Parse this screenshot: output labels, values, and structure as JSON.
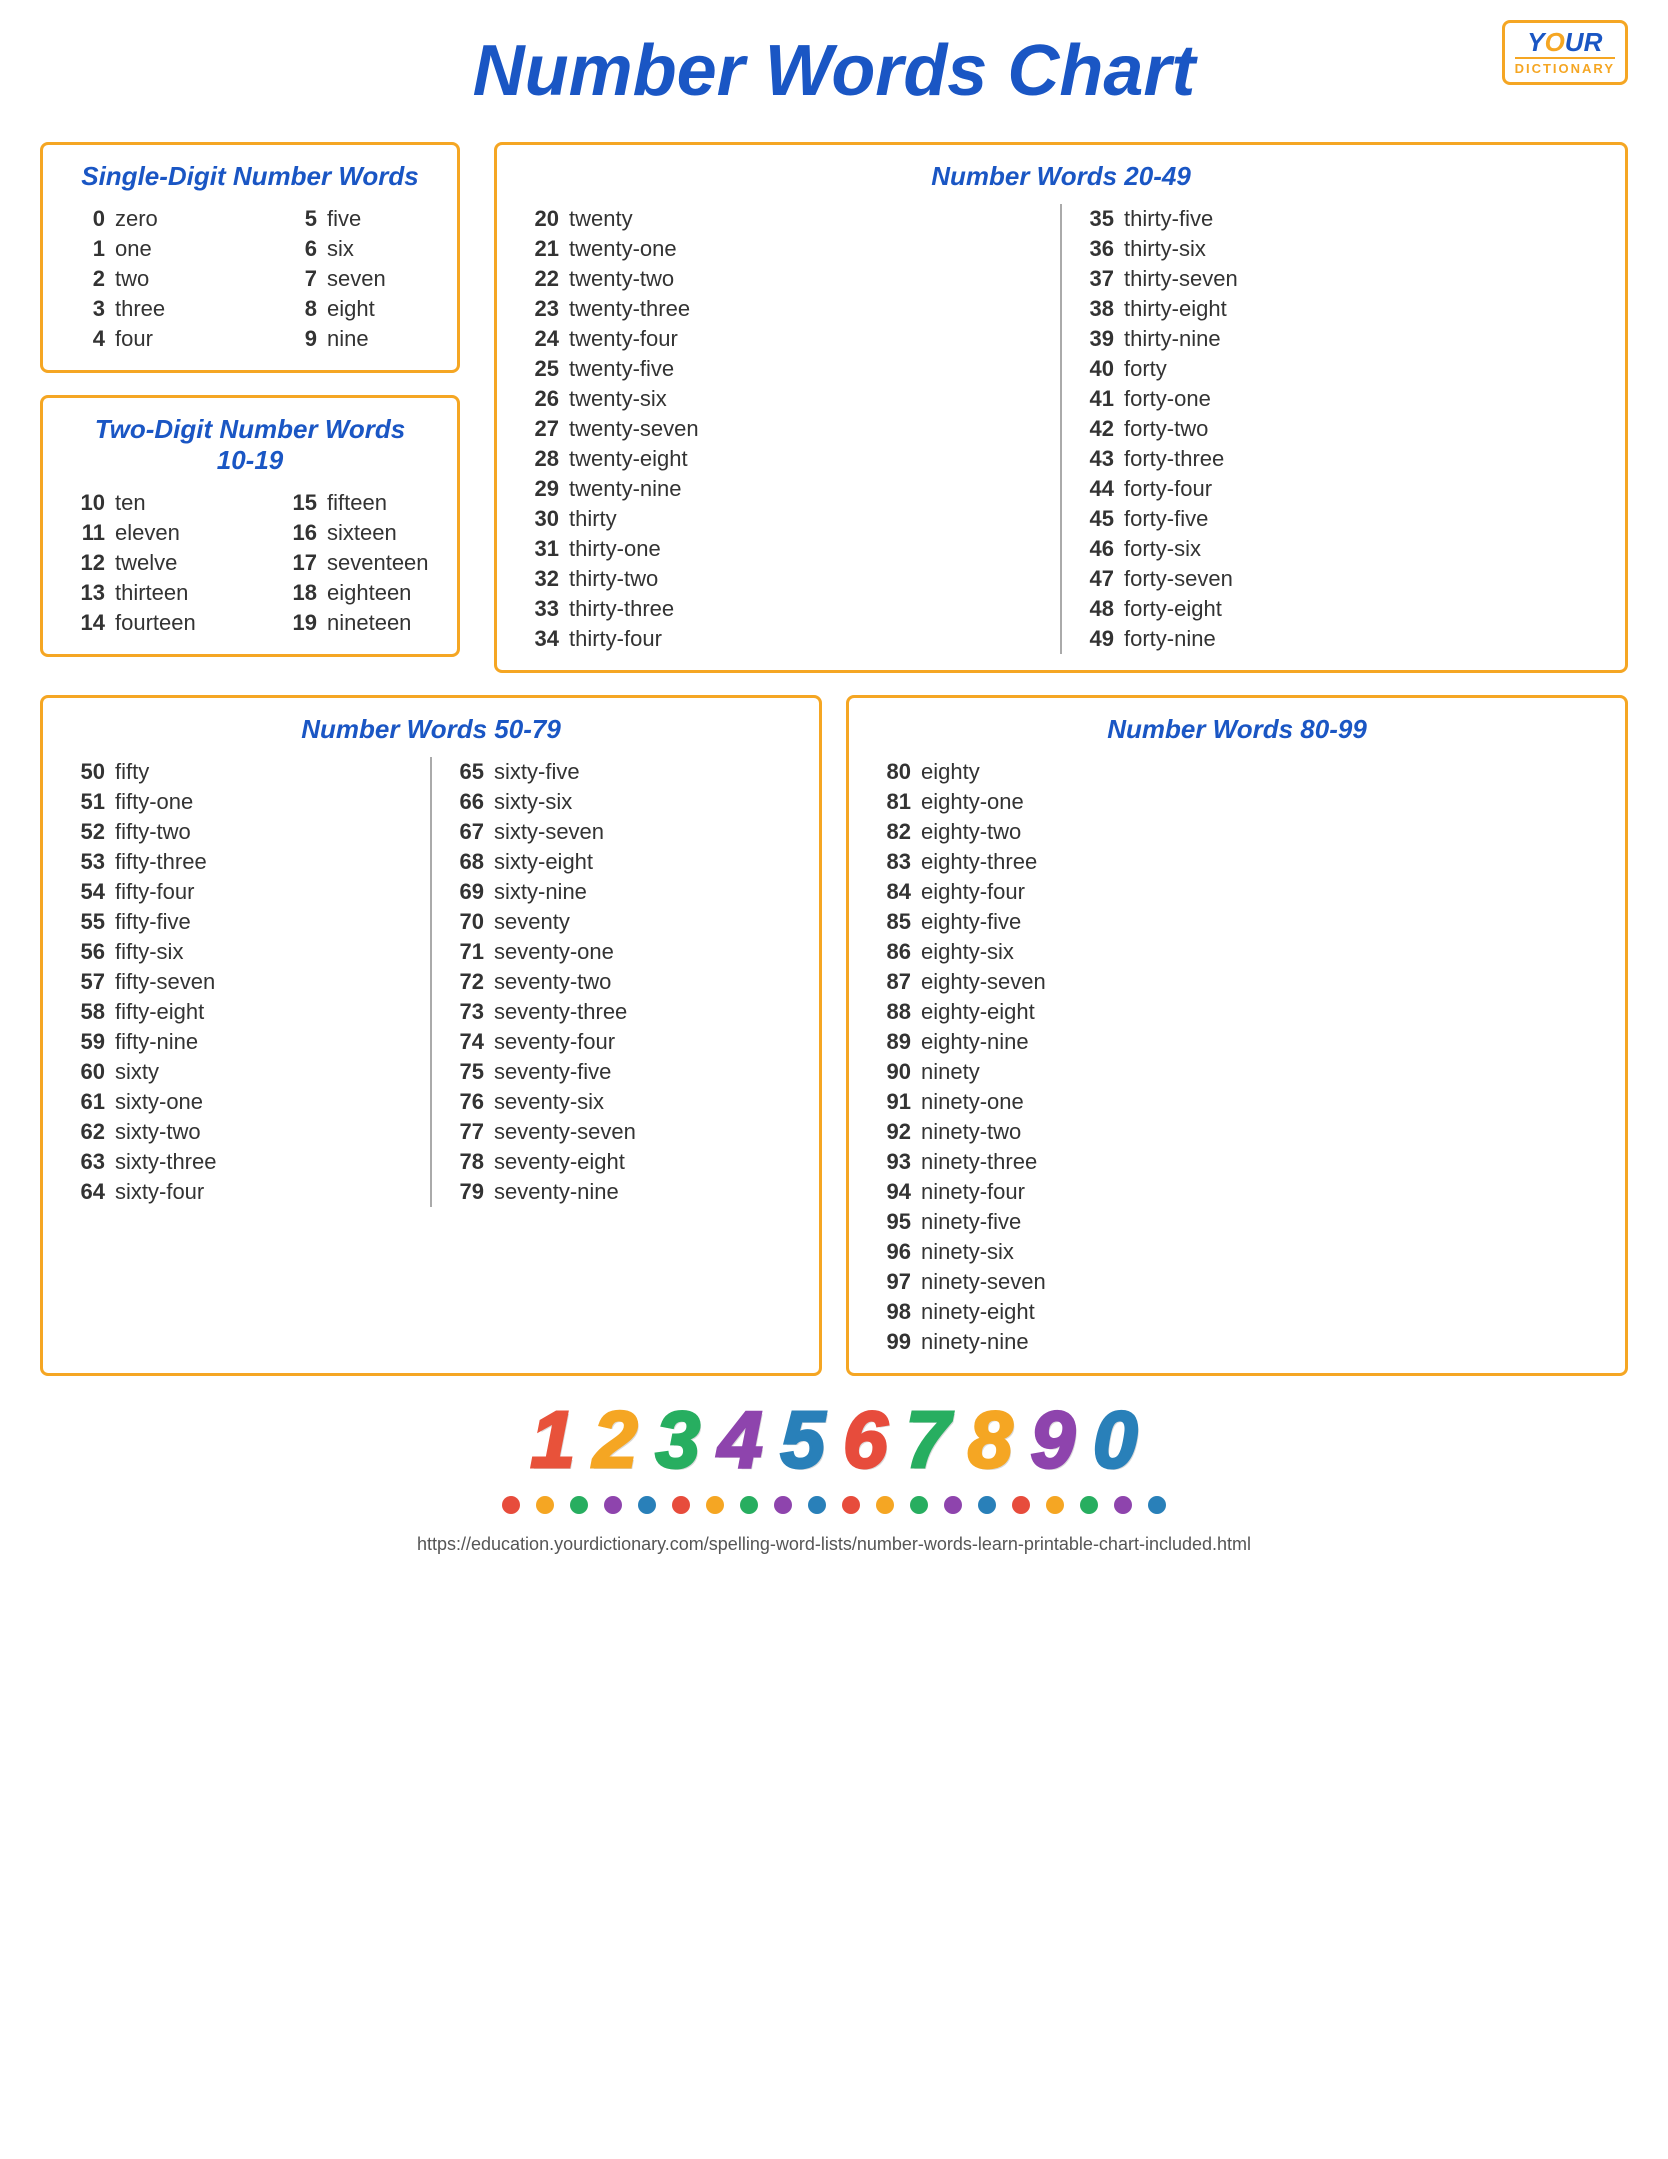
{
  "logo": {
    "your": "Y",
    "o": "O",
    "ur": "UR",
    "dictionary": "DICTIONARY"
  },
  "title": "Number Words Chart",
  "sections": {
    "single_digit": {
      "title": "Single-Digit Number Words",
      "left": [
        {
          "num": "0",
          "word": "zero"
        },
        {
          "num": "1",
          "word": "one"
        },
        {
          "num": "2",
          "word": "two"
        },
        {
          "num": "3",
          "word": "three"
        },
        {
          "num": "4",
          "word": "four"
        }
      ],
      "right": [
        {
          "num": "5",
          "word": "five"
        },
        {
          "num": "6",
          "word": "six"
        },
        {
          "num": "7",
          "word": "seven"
        },
        {
          "num": "8",
          "word": "eight"
        },
        {
          "num": "9",
          "word": "nine"
        }
      ]
    },
    "two_digit": {
      "title": "Two-Digit Number Words",
      "subtitle": "10-19",
      "left": [
        {
          "num": "10",
          "word": "ten"
        },
        {
          "num": "11",
          "word": "eleven"
        },
        {
          "num": "12",
          "word": "twelve"
        },
        {
          "num": "13",
          "word": "thirteen"
        },
        {
          "num": "14",
          "word": "fourteen"
        }
      ],
      "right": [
        {
          "num": "15",
          "word": "fifteen"
        },
        {
          "num": "16",
          "word": "sixteen"
        },
        {
          "num": "17",
          "word": "seventeen"
        },
        {
          "num": "18",
          "word": "eighteen"
        },
        {
          "num": "19",
          "word": "nineteen"
        }
      ]
    },
    "twenty_49": {
      "title": "Number Words 20-49",
      "left": [
        {
          "num": "20",
          "word": "twenty"
        },
        {
          "num": "21",
          "word": "twenty-one"
        },
        {
          "num": "22",
          "word": "twenty-two"
        },
        {
          "num": "23",
          "word": "twenty-three"
        },
        {
          "num": "24",
          "word": "twenty-four"
        },
        {
          "num": "25",
          "word": "twenty-five"
        },
        {
          "num": "26",
          "word": "twenty-six"
        },
        {
          "num": "27",
          "word": "twenty-seven"
        },
        {
          "num": "28",
          "word": "twenty-eight"
        },
        {
          "num": "29",
          "word": "twenty-nine"
        },
        {
          "num": "30",
          "word": "thirty"
        },
        {
          "num": "31",
          "word": "thirty-one"
        },
        {
          "num": "32",
          "word": "thirty-two"
        },
        {
          "num": "33",
          "word": "thirty-three"
        },
        {
          "num": "34",
          "word": "thirty-four"
        }
      ],
      "right": [
        {
          "num": "35",
          "word": "thirty-five"
        },
        {
          "num": "36",
          "word": "thirty-six"
        },
        {
          "num": "37",
          "word": "thirty-seven"
        },
        {
          "num": "38",
          "word": "thirty-eight"
        },
        {
          "num": "39",
          "word": "thirty-nine"
        },
        {
          "num": "40",
          "word": "forty"
        },
        {
          "num": "41",
          "word": "forty-one"
        },
        {
          "num": "42",
          "word": "forty-two"
        },
        {
          "num": "43",
          "word": "forty-three"
        },
        {
          "num": "44",
          "word": "forty-four"
        },
        {
          "num": "45",
          "word": "forty-five"
        },
        {
          "num": "46",
          "word": "forty-six"
        },
        {
          "num": "47",
          "word": "forty-seven"
        },
        {
          "num": "48",
          "word": "forty-eight"
        },
        {
          "num": "49",
          "word": "forty-nine"
        }
      ]
    },
    "fifty_79": {
      "title": "Number Words 50-79",
      "left": [
        {
          "num": "50",
          "word": "fifty"
        },
        {
          "num": "51",
          "word": "fifty-one"
        },
        {
          "num": "52",
          "word": "fifty-two"
        },
        {
          "num": "53",
          "word": "fifty-three"
        },
        {
          "num": "54",
          "word": "fifty-four"
        },
        {
          "num": "55",
          "word": "fifty-five"
        },
        {
          "num": "56",
          "word": "fifty-six"
        },
        {
          "num": "57",
          "word": "fifty-seven"
        },
        {
          "num": "58",
          "word": "fifty-eight"
        },
        {
          "num": "59",
          "word": "fifty-nine"
        },
        {
          "num": "60",
          "word": "sixty"
        },
        {
          "num": "61",
          "word": "sixty-one"
        },
        {
          "num": "62",
          "word": "sixty-two"
        },
        {
          "num": "63",
          "word": "sixty-three"
        },
        {
          "num": "64",
          "word": "sixty-four"
        }
      ],
      "right": [
        {
          "num": "65",
          "word": "sixty-five"
        },
        {
          "num": "66",
          "word": "sixty-six"
        },
        {
          "num": "67",
          "word": "sixty-seven"
        },
        {
          "num": "68",
          "word": "sixty-eight"
        },
        {
          "num": "69",
          "word": "sixty-nine"
        },
        {
          "num": "70",
          "word": "seventy"
        },
        {
          "num": "71",
          "word": "seventy-one"
        },
        {
          "num": "72",
          "word": "seventy-two"
        },
        {
          "num": "73",
          "word": "seventy-three"
        },
        {
          "num": "74",
          "word": "seventy-four"
        },
        {
          "num": "75",
          "word": "seventy-five"
        },
        {
          "num": "76",
          "word": "seventy-six"
        },
        {
          "num": "77",
          "word": "seventy-seven"
        },
        {
          "num": "78",
          "word": "seventy-eight"
        },
        {
          "num": "79",
          "word": "seventy-nine"
        }
      ]
    },
    "eighty_99": {
      "title": "Number Words 80-99",
      "left": [
        {
          "num": "80",
          "word": "eighty"
        },
        {
          "num": "81",
          "word": "eighty-one"
        },
        {
          "num": "82",
          "word": "eighty-two"
        },
        {
          "num": "83",
          "word": "eighty-three"
        },
        {
          "num": "84",
          "word": "eighty-four"
        },
        {
          "num": "85",
          "word": "eighty-five"
        },
        {
          "num": "86",
          "word": "eighty-six"
        },
        {
          "num": "87",
          "word": "eighty-seven"
        },
        {
          "num": "88",
          "word": "eighty-eight"
        },
        {
          "num": "89",
          "word": "eighty-nine"
        },
        {
          "num": "90",
          "word": "ninety"
        },
        {
          "num": "91",
          "word": "ninety-one"
        },
        {
          "num": "92",
          "word": "ninety-two"
        },
        {
          "num": "93",
          "word": "ninety-three"
        },
        {
          "num": "94",
          "word": "ninety-four"
        },
        {
          "num": "95",
          "word": "ninety-five"
        },
        {
          "num": "96",
          "word": "ninety-six"
        },
        {
          "num": "97",
          "word": "ninety-seven"
        },
        {
          "num": "98",
          "word": "ninety-eight"
        },
        {
          "num": "99",
          "word": "ninety-nine"
        }
      ]
    }
  },
  "deco_nums": [
    "1",
    "2",
    "3",
    "4",
    "5",
    "6",
    "7",
    "8",
    "9",
    "0"
  ],
  "dot_colors": [
    "#e74c3c",
    "#f5a623",
    "#27ae60",
    "#8e44ad",
    "#2980b9",
    "#e74c3c",
    "#f5a623",
    "#27ae60",
    "#8e44ad",
    "#2980b9",
    "#e74c3c",
    "#f5a623",
    "#27ae60",
    "#8e44ad",
    "#2980b9",
    "#e74c3c",
    "#f5a623",
    "#27ae60",
    "#8e44ad",
    "#2980b9"
  ],
  "footer_url": "https://education.yourdictionary.com/spelling-word-lists/number-words-learn-printable-chart-included.html"
}
